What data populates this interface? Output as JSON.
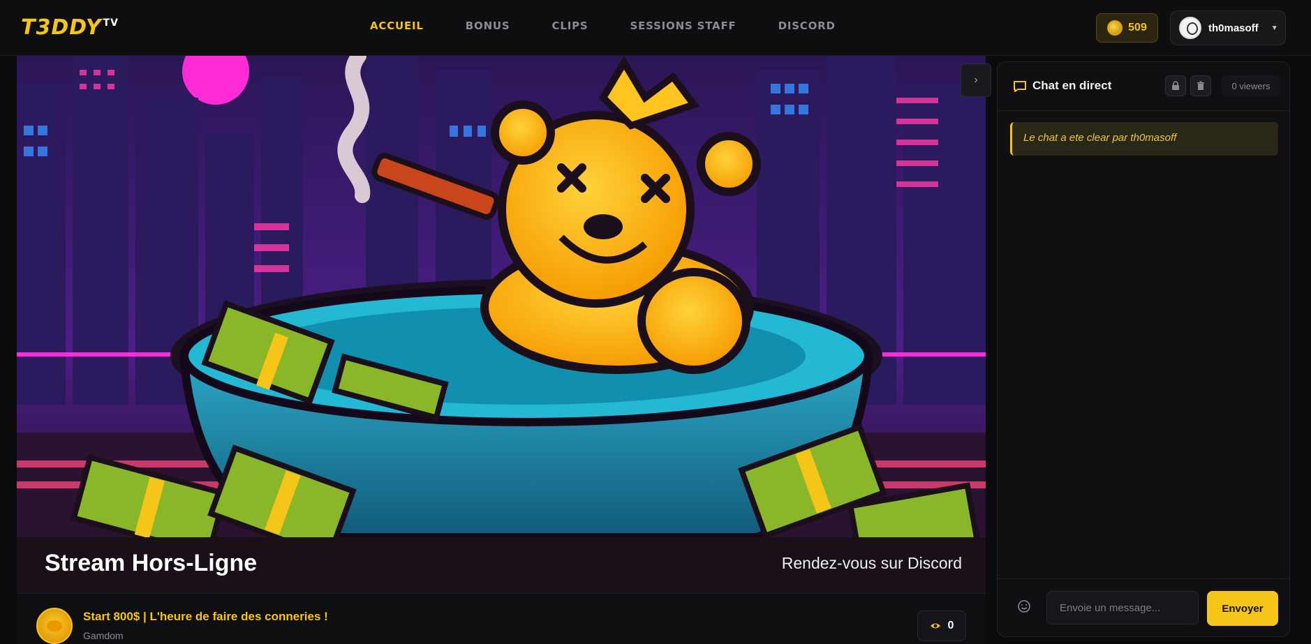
{
  "brand": {
    "logo": "T3DDY",
    "logo_sup": "TV",
    "accent": "#f5c518"
  },
  "nav": {
    "items": [
      {
        "label": "ACCUEIL",
        "active": true
      },
      {
        "label": "BONUS",
        "active": false
      },
      {
        "label": "CLIPS",
        "active": false
      },
      {
        "label": "SESSIONS STAFF",
        "active": false
      },
      {
        "label": "DISCORD",
        "active": false
      }
    ]
  },
  "account": {
    "coins": "509",
    "username": "th0masoff",
    "coin_icon": "coin-icon",
    "caret_icon": "caret-down-icon"
  },
  "stream": {
    "offline_title": "Stream Hors-Ligne",
    "offline_subtitle": "Rendez-vous sur Discord",
    "title": "Start 800$ | L'heure de faire des conneries !",
    "category": "Gamdom",
    "viewer_count": "0",
    "collapse_icon": "chevron-right-icon"
  },
  "chat": {
    "title": "Chat en direct",
    "viewers": "0 viewers",
    "system_message": "Le chat a ete clear par th0masoff",
    "input_placeholder": "Envoie un message...",
    "send_label": "Envoyer",
    "icons": [
      "chat-bubble-icon",
      "lock-icon",
      "trash-icon",
      "smile-icon"
    ]
  }
}
